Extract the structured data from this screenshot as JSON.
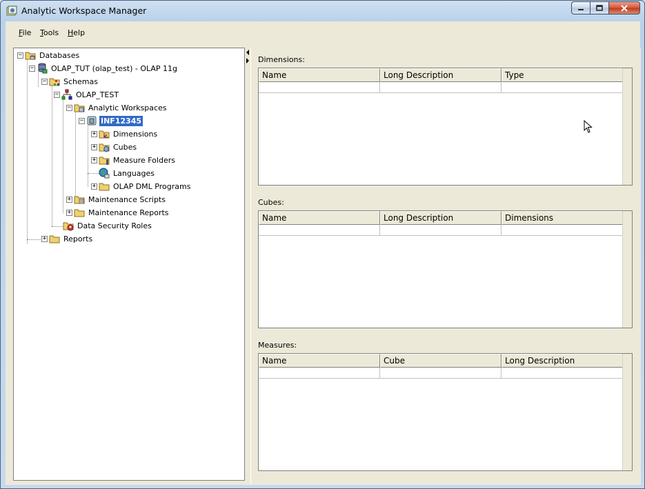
{
  "window": {
    "title": "Analytic Workspace Manager"
  },
  "menu": {
    "file": "File",
    "file_acc": "F",
    "file_rest": "ile",
    "tools_acc": "T",
    "tools_rest": "ools",
    "help_acc": "H",
    "help_rest": "elp"
  },
  "tree": {
    "databases": "Databases",
    "connection": "OLAP_TUT (olap_test) - OLAP 11g",
    "schemas": "Schemas",
    "schema": "OLAP_TEST",
    "analytic_workspaces": "Analytic Workspaces",
    "workspace": "INF12345",
    "dimensions": "Dimensions",
    "cubes": "Cubes",
    "measure_folders": "Measure Folders",
    "languages": "Languages",
    "olap_dml_programs": "OLAP DML Programs",
    "maintenance_scripts": "Maintenance Scripts",
    "maintenance_reports": "Maintenance Reports",
    "data_security_roles": "Data Security Roles",
    "reports": "Reports"
  },
  "sections": {
    "dimensions": {
      "label": "Dimensions:",
      "columns": [
        "Name",
        "Long Description",
        "Type"
      ]
    },
    "cubes": {
      "label": "Cubes:",
      "columns": [
        "Name",
        "Long Description",
        "Dimensions"
      ]
    },
    "measures": {
      "label": "Measures:",
      "columns": [
        "Name",
        "Cube",
        "Long Description"
      ]
    }
  },
  "colors": {
    "selection": "#316ac5",
    "panel_bg": "#ece9d8"
  },
  "icons": [
    "app-icon",
    "minimize-icon",
    "maximize-icon",
    "close-icon",
    "database-folder-icon",
    "database-connection-icon",
    "schemas-folder-icon",
    "schema-icon",
    "workspaces-folder-icon",
    "workspace-icon",
    "dimensions-folder-icon",
    "cubes-folder-icon",
    "measure-folders-icon",
    "languages-icon",
    "folder-icon",
    "maintenance-scripts-icon",
    "security-roles-icon"
  ]
}
